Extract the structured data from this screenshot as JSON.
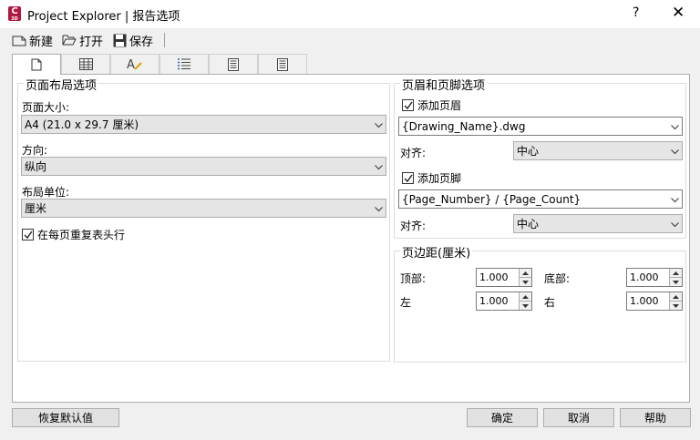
{
  "window": {
    "title": "Project Explorer | 报告选项",
    "app_icon_letter": "C",
    "app_icon_sub": "3D",
    "help_glyph": "?",
    "close_glyph": "✕"
  },
  "toolbar": {
    "new_label": "新建",
    "open_label": "打开",
    "save_label": "保存"
  },
  "tabs": [
    {
      "icon": "page-icon",
      "active": true
    },
    {
      "icon": "table-icon",
      "active": false
    },
    {
      "icon": "text-style-icon",
      "active": false
    },
    {
      "icon": "list-icon",
      "active": false
    },
    {
      "icon": "columns-icon",
      "active": false
    },
    {
      "icon": "document-icon",
      "active": false
    }
  ],
  "page_layout": {
    "group_title": "页面布局选项",
    "page_size_label": "页面大小:",
    "page_size_value": "A4 (21.0 x 29.7 厘米)",
    "orientation_label": "方向:",
    "orientation_value": "纵向",
    "units_label": "布局单位:",
    "units_value": "厘米",
    "repeat_header_label": "在每页重复表头行",
    "repeat_header_checked": true
  },
  "header_footer": {
    "group_title": "页眉和页脚选项",
    "add_header_label": "添加页眉",
    "add_header_checked": true,
    "header_value": "{Drawing_Name}.dwg",
    "header_align_label": "对齐:",
    "header_align_value": "中心",
    "add_footer_label": "添加页脚",
    "add_footer_checked": true,
    "footer_value": "{Page_Number} / {Page_Count}",
    "footer_align_label": "对齐:",
    "footer_align_value": "中心"
  },
  "margins": {
    "group_title": "页边距(厘米)",
    "top_label": "顶部:",
    "top_value": "1.000",
    "bottom_label": "底部:",
    "bottom_value": "1.000",
    "left_label": "左",
    "left_value": "1.000",
    "right_label": "右",
    "right_value": "1.000"
  },
  "footer_buttons": {
    "restore_label": "恢复默认值",
    "ok_label": "确定",
    "cancel_label": "取消",
    "help_label": "帮助"
  }
}
